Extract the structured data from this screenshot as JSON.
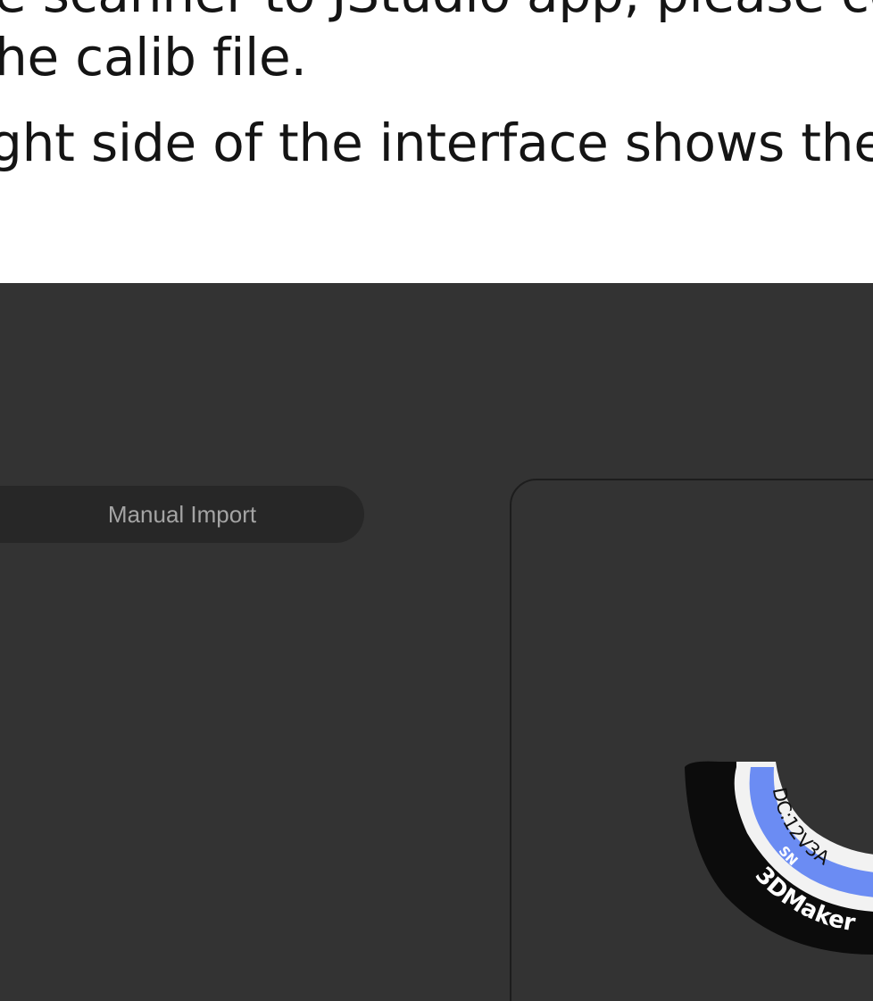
{
  "document": {
    "line1": "e scanner to JStudio app, please conn",
    "line2": "he calib file.",
    "line3": "ght side of the interface shows the scan"
  },
  "app": {
    "manual_import_label": "Manual Import"
  },
  "device_label": {
    "rating": "DC:12V3A",
    "serial_prefix": "SN",
    "brand": "3DMaker"
  },
  "colors": {
    "page_background": "#ffffff",
    "text": "#141414",
    "app_background": "#333333",
    "button_background": "#272727",
    "button_text": "#a4a4a4",
    "device_label_blue": "#6b8cf3",
    "device_body": "#0c0c0c"
  },
  "icons": {
    "device": "scanner-device-icon"
  }
}
